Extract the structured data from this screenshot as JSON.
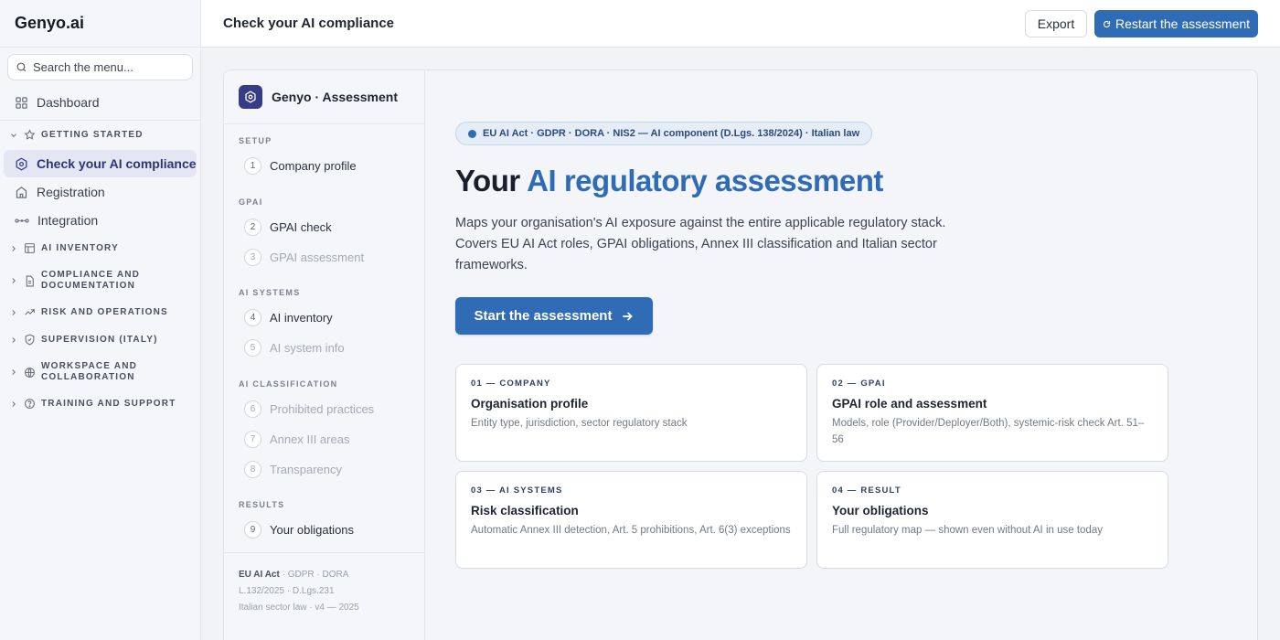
{
  "app": {
    "name": "Genyo.ai"
  },
  "colors": {
    "accent": "#2f6cb5",
    "brand_dark": "#373c88",
    "active_bg": "#e4e6f3"
  },
  "sidebar": {
    "search_placeholder": "Search the menu...",
    "items": [
      {
        "label": "Dashboard",
        "icon": "grid-icon"
      },
      {
        "label": "Check your AI compliance",
        "icon": "shield-hex-icon",
        "active": true
      },
      {
        "label": "Registration",
        "icon": "building-icon"
      },
      {
        "label": "Integration",
        "icon": "link-icon"
      }
    ],
    "groups": [
      {
        "label": "GETTING STARTED",
        "icon": "star-icon",
        "expanded": true
      },
      {
        "label": "AI INVENTORY",
        "icon": "table-icon"
      },
      {
        "label": "COMPLIANCE AND DOCUMENTATION",
        "icon": "document-icon"
      },
      {
        "label": "RISK AND OPERATIONS",
        "icon": "trend-icon"
      },
      {
        "label": "SUPERVISION (ITALY)",
        "icon": "shield-check-icon"
      },
      {
        "label": "WORKSPACE AND COLLABORATION",
        "icon": "globe-icon"
      },
      {
        "label": "TRAINING AND SUPPORT",
        "icon": "help-circle-icon"
      }
    ]
  },
  "header": {
    "title": "Check your AI compliance",
    "export_label": "Export",
    "restart_label": "Restart the assessment"
  },
  "wizard": {
    "title": "Genyo · Assessment",
    "sections": [
      {
        "label": "SETUP"
      },
      {
        "label": "GPAI"
      },
      {
        "label": "AI SYSTEMS"
      },
      {
        "label": "AI CLASSIFICATION"
      },
      {
        "label": "RESULTS"
      }
    ],
    "steps": [
      {
        "num": "1",
        "label": "Company profile",
        "enabled": true
      },
      {
        "num": "2",
        "label": "GPAI check",
        "enabled": true
      },
      {
        "num": "3",
        "label": "GPAI assessment",
        "enabled": false
      },
      {
        "num": "4",
        "label": "AI inventory",
        "enabled": true
      },
      {
        "num": "5",
        "label": "AI system info",
        "enabled": false
      },
      {
        "num": "6",
        "label": "Prohibited practices",
        "enabled": false
      },
      {
        "num": "7",
        "label": "Annex III areas",
        "enabled": false
      },
      {
        "num": "8",
        "label": "Transparency",
        "enabled": false
      },
      {
        "num": "9",
        "label": "Your obligations",
        "enabled": true
      }
    ],
    "footer": {
      "bold": "EU AI Act",
      "line1_rest": " · GDPR · DORA",
      "line2": "L.132/2025 · D.Lgs.231",
      "line3": "Italian sector law · v4 — 2025"
    }
  },
  "main": {
    "pill": "EU AI Act · GDPR · DORA · NIS2 — AI component (D.Lgs. 138/2024) · Italian law",
    "title_plain": "Your ",
    "title_accent": "AI regulatory assessment",
    "description": "Maps your organisation's AI exposure against the entire applicable regulatory stack. Covers EU AI Act roles, GPAI obligations, Annex III classification and Italian sector frameworks.",
    "start_label": "Start the assessment",
    "cards": [
      {
        "kicker": "01 — COMPANY",
        "title": "Organisation profile",
        "desc": "Entity type, jurisdiction, sector regulatory stack"
      },
      {
        "kicker": "02 — GPAI",
        "title": "GPAI role and assessment",
        "desc": "Models, role (Provider/Deployer/Both), systemic-risk check Art. 51–56"
      },
      {
        "kicker": "03 — AI SYSTEMS",
        "title": "Risk classification",
        "desc": "Automatic Annex III detection, Art. 5 prohibitions, Art. 6(3) exceptions"
      },
      {
        "kicker": "04 — RESULT",
        "title": "Your obligations",
        "desc": "Full regulatory map — shown even without AI in use today"
      }
    ]
  }
}
